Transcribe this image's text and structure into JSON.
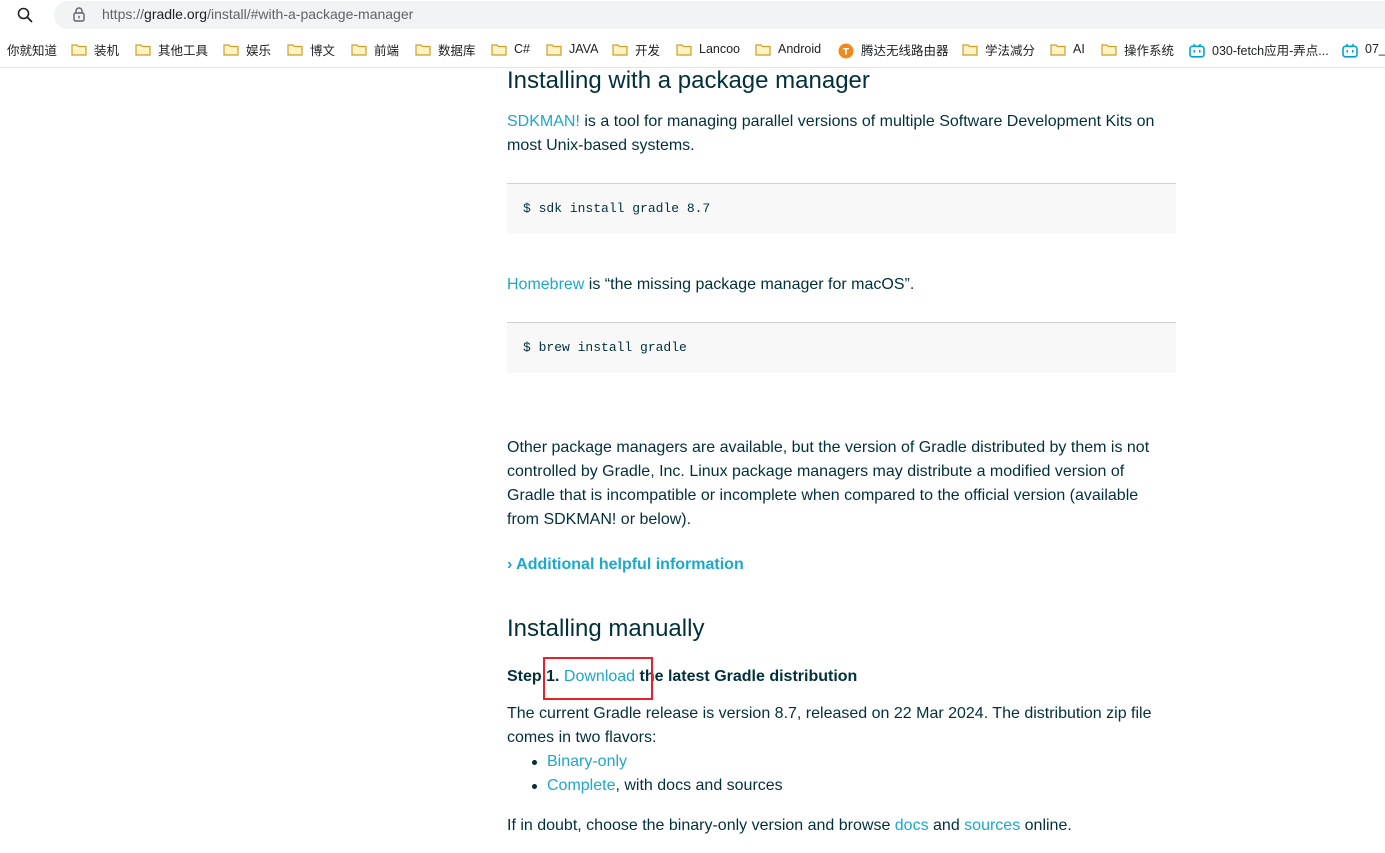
{
  "browser": {
    "url_prefix": "https://",
    "url_host": "gradle.org",
    "url_path": "/install/#with-a-package-manager"
  },
  "bookmarks": [
    {
      "label": "你就知道",
      "icon": "none"
    },
    {
      "label": "装机",
      "icon": "folder-icon"
    },
    {
      "label": "其他工具",
      "icon": "folder-icon"
    },
    {
      "label": "娱乐",
      "icon": "folder-icon"
    },
    {
      "label": "博文",
      "icon": "folder-icon"
    },
    {
      "label": "前端",
      "icon": "folder-icon"
    },
    {
      "label": "数据库",
      "icon": "folder-icon"
    },
    {
      "label": "C#",
      "icon": "folder-icon"
    },
    {
      "label": "JAVA",
      "icon": "folder-icon"
    },
    {
      "label": "开发",
      "icon": "folder-icon"
    },
    {
      "label": "Lancoo",
      "icon": "folder-icon"
    },
    {
      "label": "Android",
      "icon": "folder-icon"
    },
    {
      "label": "腾达无线路由器",
      "icon": "tenda-icon"
    },
    {
      "label": "学法减分",
      "icon": "folder-icon"
    },
    {
      "label": "AI",
      "icon": "folder-icon"
    },
    {
      "label": "操作系统",
      "icon": "folder-icon"
    },
    {
      "label": "030-fetch应用-弄点...",
      "icon": "bilibili-icon"
    },
    {
      "label": "07_",
      "icon": "bilibili-icon"
    }
  ],
  "section1": {
    "heading": "Installing with a package manager",
    "sdkman_link": "SDKMAN!",
    "sdkman_text": " is a tool for managing parallel versions of multiple Software Development Kits on most Unix-based systems.",
    "sdkman_cmd": "$ sdk install gradle 8.7",
    "homebrew_link": "Homebrew",
    "homebrew_text": " is “the missing package manager for macOS”.",
    "homebrew_cmd": "$ brew install gradle",
    "other_text": "Other package managers are available, but the version of Gradle distributed by them is not controlled by Gradle, Inc. Linux package managers may distribute a modified version of Gradle that is incompatible or incomplete when compared to the official version (available from SDKMAN! or below).",
    "additional_info": "› Additional helpful information"
  },
  "section2": {
    "heading": "Installing manually",
    "step_prefix": "Step 1. ",
    "download_link": "Download",
    "step_suffix": " the latest Gradle distribution",
    "release_text": "The current Gradle release is version 8.7, released on 22 Mar 2024. The distribution zip file comes in two flavors:",
    "flavor1_link": "Binary-only",
    "flavor2_link": "Complete",
    "flavor2_text": ", with docs and sources",
    "doubt_prefix": "If in doubt, choose the binary-only version and browse ",
    "docs_link": "docs",
    "doubt_and": " and ",
    "sources_link": "sources",
    "doubt_suffix": " online."
  },
  "colors": {
    "link": "#1ba8cb",
    "text": "#02303a",
    "highlight": "#e8202a",
    "folder": "#f2c94c"
  }
}
